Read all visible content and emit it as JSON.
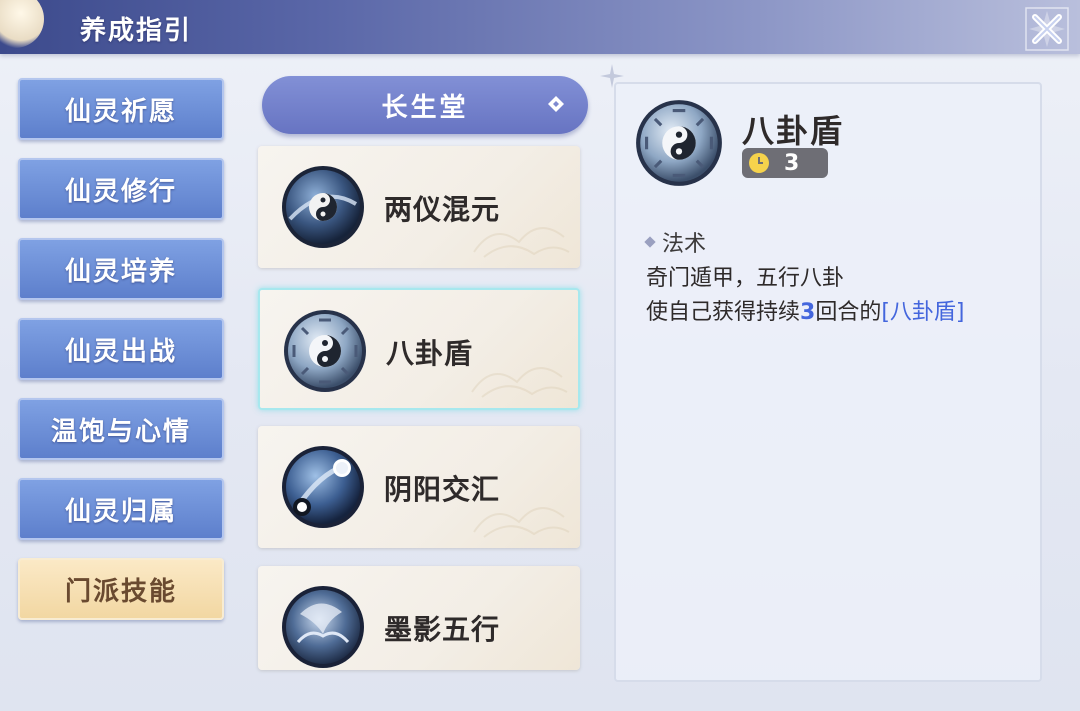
{
  "header": {
    "title": "养成指引"
  },
  "nav": {
    "items": [
      {
        "label": "仙灵祈愿"
      },
      {
        "label": "仙灵修行"
      },
      {
        "label": "仙灵培养"
      },
      {
        "label": "仙灵出战"
      },
      {
        "label": "温饱与心情"
      },
      {
        "label": "仙灵归属"
      },
      {
        "label": "门派技能",
        "active": true
      }
    ]
  },
  "dropdown": {
    "selected": "长生堂"
  },
  "skills": [
    {
      "name": "两仪混元",
      "icon": "taiji-orb-icon"
    },
    {
      "name": "八卦盾",
      "icon": "bagua-shield-icon",
      "selected": true
    },
    {
      "name": "阴阳交汇",
      "icon": "yinyang-meet-icon"
    },
    {
      "name": "墨影五行",
      "icon": "ink-five-elements-icon"
    }
  ],
  "detail": {
    "name": "八卦盾",
    "cooldown": "3",
    "tag": "法术",
    "line1": "奇门遁甲，五行八卦",
    "line2_prefix": "使自己获得持续",
    "line2_num": "3",
    "line2_mid": "回合的",
    "line2_link": "[八卦盾]"
  },
  "colors": {
    "accent_blue": "#4466dd",
    "nav_blue": "#6f8fd8",
    "nav_active": "#f5dcaa"
  }
}
